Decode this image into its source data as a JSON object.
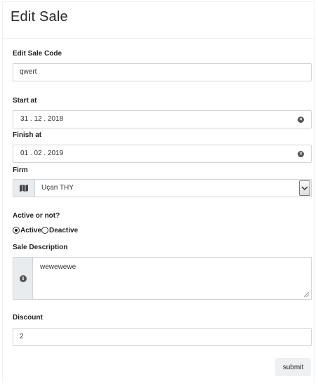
{
  "title": "Edit Sale",
  "fields": {
    "code": {
      "label": "Edit Sale Code",
      "value": "qwert"
    },
    "start": {
      "label": "Start at",
      "value": "31 . 12 . 2018"
    },
    "finish": {
      "label": "Finish at",
      "value": "01 . 02 . 2019"
    },
    "firm": {
      "label": "Firm",
      "selected": "Uçan THY",
      "icon": "map-icon"
    },
    "active": {
      "label": "Active or not?",
      "options": [
        {
          "label": "Active",
          "checked": true
        },
        {
          "label": "Deactive",
          "checked": false
        }
      ]
    },
    "description": {
      "label": "Sale Description",
      "value": "wewewewe",
      "icon": "info-icon"
    },
    "discount": {
      "label": "Discount",
      "value": "2"
    }
  },
  "submit_label": "submit"
}
